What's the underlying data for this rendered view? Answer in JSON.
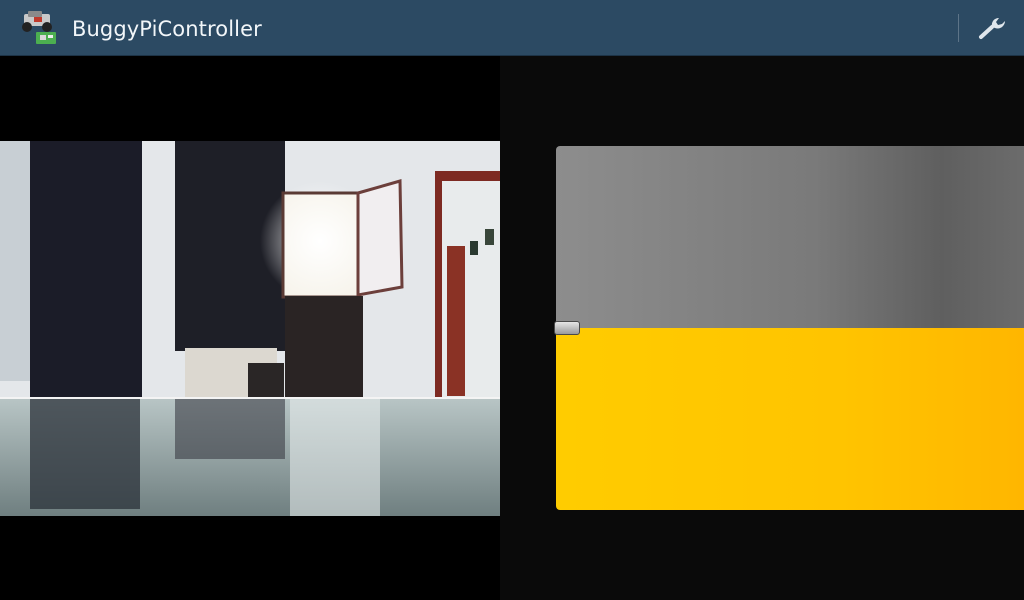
{
  "app": {
    "title": "BuggyPiController",
    "icon": "buggy-car-icon"
  },
  "action_bar": {
    "settings_icon": "wrench-icon",
    "color": "#2c4a63"
  },
  "camera": {
    "description_icon": "camera-feed"
  },
  "throttle_control": {
    "level": 0.5,
    "upper_color": "#7a7a7a",
    "lower_color": "#ffc400"
  }
}
